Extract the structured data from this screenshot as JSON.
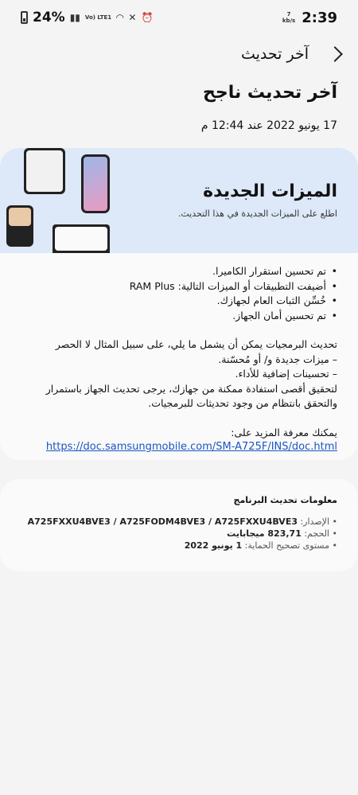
{
  "status_bar": {
    "battery": "24%",
    "volte": "Vo) LTE1",
    "speed_value": "7",
    "speed_unit": "kb/s",
    "time": "2:39"
  },
  "header": {
    "title": "آخر تحديث"
  },
  "page_title": "آخر تحديث ناجح",
  "update_date": "17 يونيو 2022 عند 12:44 م",
  "features_card": {
    "banner_title": "الميزات الجديدة",
    "banner_subtitle": "اطلع على الميزات الجديدة في هذا التحديث.",
    "bullets": [
      "تم تحسين استقرار الكاميرا.",
      "أضيفت التطبيقات أو الميزات التالية: RAM Plus",
      "خُسِّن الثبات العام لجهازك.",
      "تم تحسين أمان الجهاز."
    ],
    "para_intro": "تحديث البرمجيات يمكن أن يشمل ما يلي، على سبيل المثال لا الحصر",
    "para_line1": "– ميزات جديدة و/ أو مُحسّنة.",
    "para_line2": "– تحسينات إضافية للأداء.",
    "para_outro": "لتحقيق أقصى استفادة ممكنة من جهازك، يرجى تحديث الجهاز باستمرار والتحقق بانتظام من وجود تحديثات للبرمجيات.",
    "learn_more": "يمكنك معرفة المزيد على:",
    "link": "https://doc.samsungmobile.com/SM-A725F/INS/doc.html"
  },
  "info_card": {
    "heading": "معلومات تحديث البرنامج",
    "version_label": "الإصدار: ",
    "version_value": "A725FXXU4BVE3 / A725FODM4BVE3 / A725FXXU4BVE3",
    "size_label": "الحجم: ",
    "size_value": "823,71 ميجابايت",
    "patch_label": "مستوى تصحيح الحماية: ",
    "patch_value": "1 يونيو 2022"
  },
  "colors": {
    "banner": "#dde9f8",
    "link": "#1a55c4",
    "background": "#f4f4f4"
  }
}
